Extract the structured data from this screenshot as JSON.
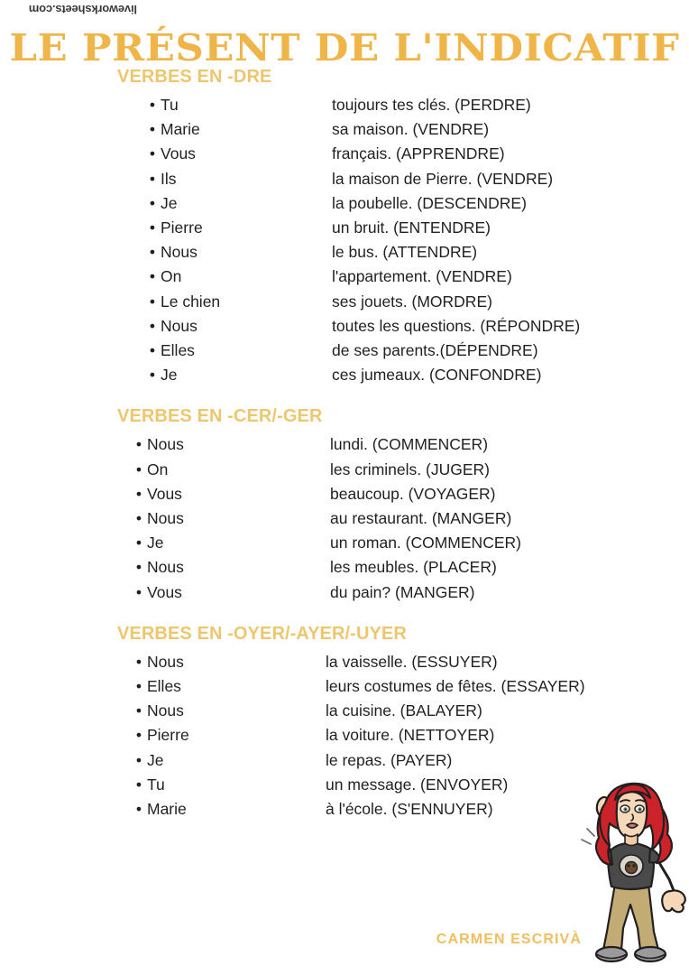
{
  "watermark": {
    "text": "liveworksheets.com"
  },
  "title": "LE PRÉSENT DE L'INDICATIF",
  "colors": {
    "title": "#f0b548",
    "heading": "#edc66e",
    "signature": "#eebf5e",
    "body_text": "#231f20",
    "background": "#ffffff",
    "hair": "#cc2229",
    "shirt": "#4a4a4a",
    "pants": "#c3ab75",
    "skin": "#f5d8b8",
    "shoes": "#9a9a9a"
  },
  "bullet_glyph": "•",
  "sections": [
    {
      "heading": "VERBES EN -DRE",
      "items": [
        {
          "subject": "Tu",
          "predicate": "toujours tes clés. (PERDRE)"
        },
        {
          "subject": "Marie",
          "predicate": "sa maison. (VENDRE)"
        },
        {
          "subject": "Vous",
          "predicate": "français. (APPRENDRE)"
        },
        {
          "subject": "Ils",
          "predicate": "la maison de Pierre. (VENDRE)"
        },
        {
          "subject": "Je",
          "predicate": "la poubelle. (DESCENDRE)"
        },
        {
          "subject": "Pierre",
          "predicate": "un bruit. (ENTENDRE)"
        },
        {
          "subject": "Nous",
          "predicate": "le bus. (ATTENDRE)"
        },
        {
          "subject": "On",
          "predicate": "l'appartement. (VENDRE)"
        },
        {
          "subject": "Le chien",
          "predicate": "ses jouets. (MORDRE)"
        },
        {
          "subject": "Nous",
          "predicate": "toutes les questions. (RÉPONDRE)"
        },
        {
          "subject": "Elles",
          "predicate": "de ses parents.(DÉPENDRE)"
        },
        {
          "subject": "Je",
          "predicate": "ces jumeaux. (CONFONDRE)"
        }
      ]
    },
    {
      "heading": "VERBES EN -CER/-GER",
      "items": [
        {
          "subject": "Nous",
          "predicate": "lundi. (COMMENCER)"
        },
        {
          "subject": "On",
          "predicate": "les criminels. (JUGER)"
        },
        {
          "subject": "Vous",
          "predicate": "beaucoup. (VOYAGER)"
        },
        {
          "subject": "Nous",
          "predicate": "au restaurant. (MANGER)"
        },
        {
          "subject": "Je",
          "predicate": "un roman. (COMMENCER)"
        },
        {
          "subject": "Nous",
          "predicate": "les meubles. (PLACER)"
        },
        {
          "subject": "Vous",
          "predicate": "du pain? (MANGER)"
        }
      ]
    },
    {
      "heading": "VERBES EN -OYER/-AYER/-UYER",
      "items": [
        {
          "subject": "Nous",
          "predicate": "la vaisselle. (ESSUYER)"
        },
        {
          "subject": "Elles",
          "predicate": "leurs costumes de fêtes. (ESSAYER)"
        },
        {
          "subject": "Nous",
          "predicate": "la cuisine. (BALAYER)"
        },
        {
          "subject": "Pierre",
          "predicate": "la voiture. (NETTOYER)"
        },
        {
          "subject": "Je",
          "predicate": "le repas. (PAYER)"
        },
        {
          "subject": "Tu",
          "predicate": "un message. (ENVOYER)"
        },
        {
          "subject": "Marie",
          "predicate": "à l'école. (S'ENNUYER)"
        }
      ]
    }
  ],
  "signature": "CARMEN ESCRIVÀ",
  "avatar": {
    "description": "waving-woman-bitmoji"
  }
}
